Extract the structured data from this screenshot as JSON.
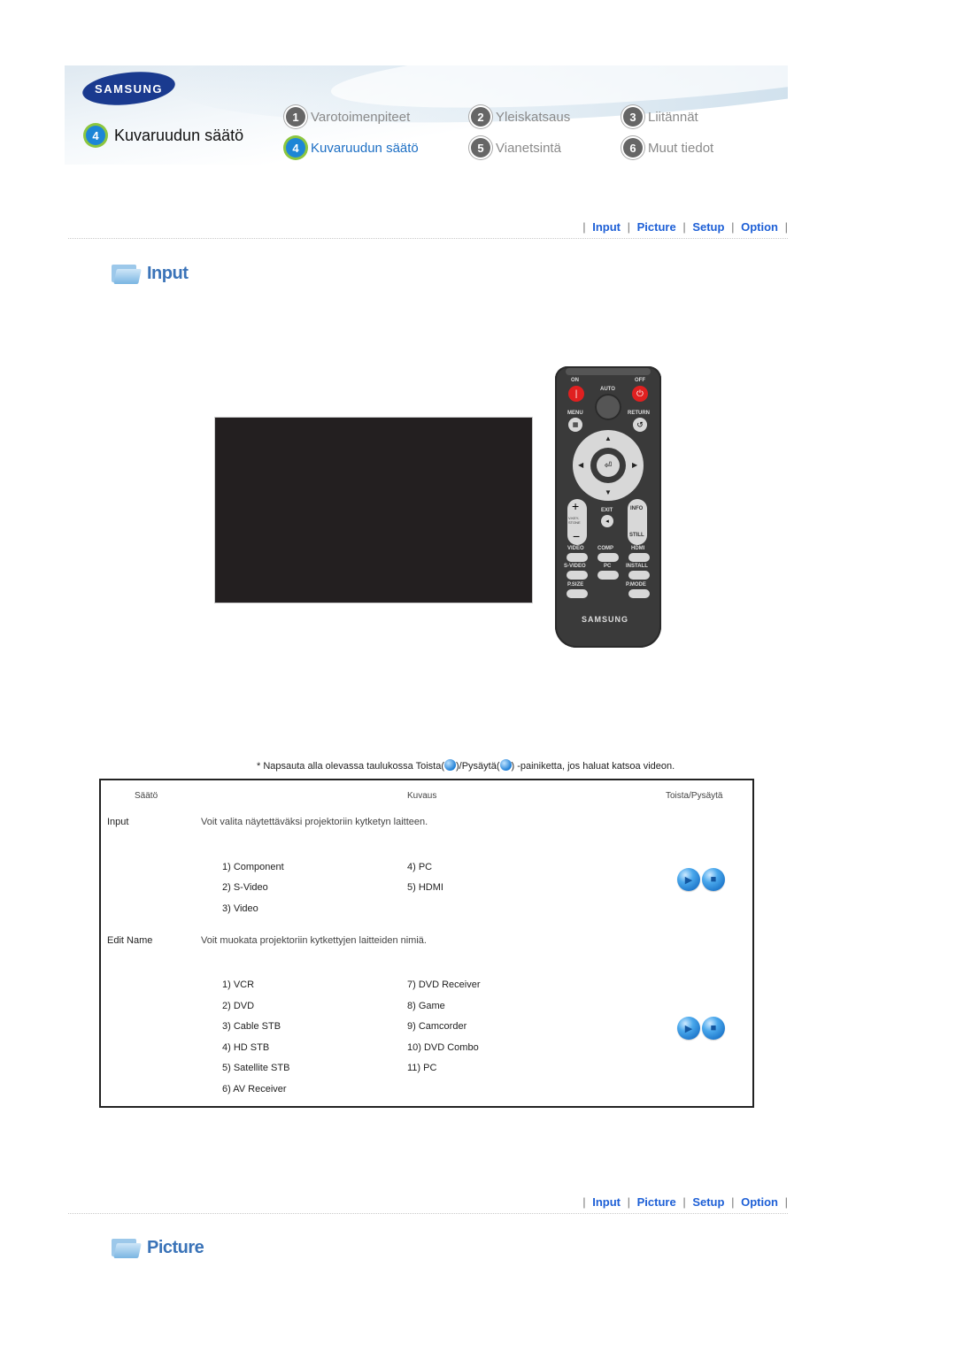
{
  "header": {
    "brand": "SAMSUNG",
    "current_section": {
      "number": "4",
      "label": "Kuvaruudun säätö"
    },
    "nav": [
      {
        "number": "1",
        "label": "Varotoimenpiteet",
        "active": false
      },
      {
        "number": "2",
        "label": "Yleiskatsaus",
        "active": false
      },
      {
        "number": "3",
        "label": "Liitännät",
        "active": false
      },
      {
        "number": "4",
        "label": "Kuvaruudun säätö",
        "active": true
      },
      {
        "number": "5",
        "label": "Vianetsintä",
        "active": false
      },
      {
        "number": "6",
        "label": "Muut tiedot",
        "active": false
      }
    ]
  },
  "subnav": {
    "separator": "|",
    "links": [
      "Input",
      "Picture",
      "Setup",
      "Option"
    ]
  },
  "sections": {
    "input_title": "Input",
    "picture_title": "Picture"
  },
  "remote": {
    "brand": "SAMSUNG",
    "labels": {
      "on": "ON",
      "off": "OFF",
      "auto": "AUTO",
      "menu": "MENU",
      "return": "RETURN",
      "exit": "EXIT",
      "info": "INFO",
      "vkeystone": "V.KEY-STONE",
      "still": "STILL",
      "video": "VIDEO",
      "comp": "COMP",
      "hdmi": "HDMI",
      "svideo": "S-VIDEO",
      "pc": "PC",
      "install": "INSTALL",
      "psize": "P.SIZE",
      "pmode": "P.MODE"
    }
  },
  "note": {
    "prefix": "* Napsauta alla olevassa taulukossa Toista(",
    "middle": ")/Pysäytä(",
    "suffix": ") -painiketta, jos haluat katsoa videon."
  },
  "table": {
    "headers": {
      "setting": "Säätö",
      "description": "Kuvaus",
      "playstop": "Toista/Pysäytä"
    },
    "rows": [
      {
        "name": "Input",
        "description": "Voit valita näytettäväksi projektoriin kytketyn laitteen.",
        "options_left": [
          "1) Component",
          "2) S-Video",
          "3) Video"
        ],
        "options_right": [
          "4) PC",
          "5) HDMI"
        ]
      },
      {
        "name": "Edit Name",
        "description": "Voit muokata projektoriin kytkettyjen laitteiden nimiä.",
        "options_left": [
          "1) VCR",
          "2) DVD",
          "3) Cable STB",
          "4) HD STB",
          "5) Satellite STB",
          "6) AV Receiver"
        ],
        "options_right": [
          "7) DVD Receiver",
          "8) Game",
          "9) Camcorder",
          "10) DVD Combo",
          "11) PC"
        ]
      }
    ]
  }
}
